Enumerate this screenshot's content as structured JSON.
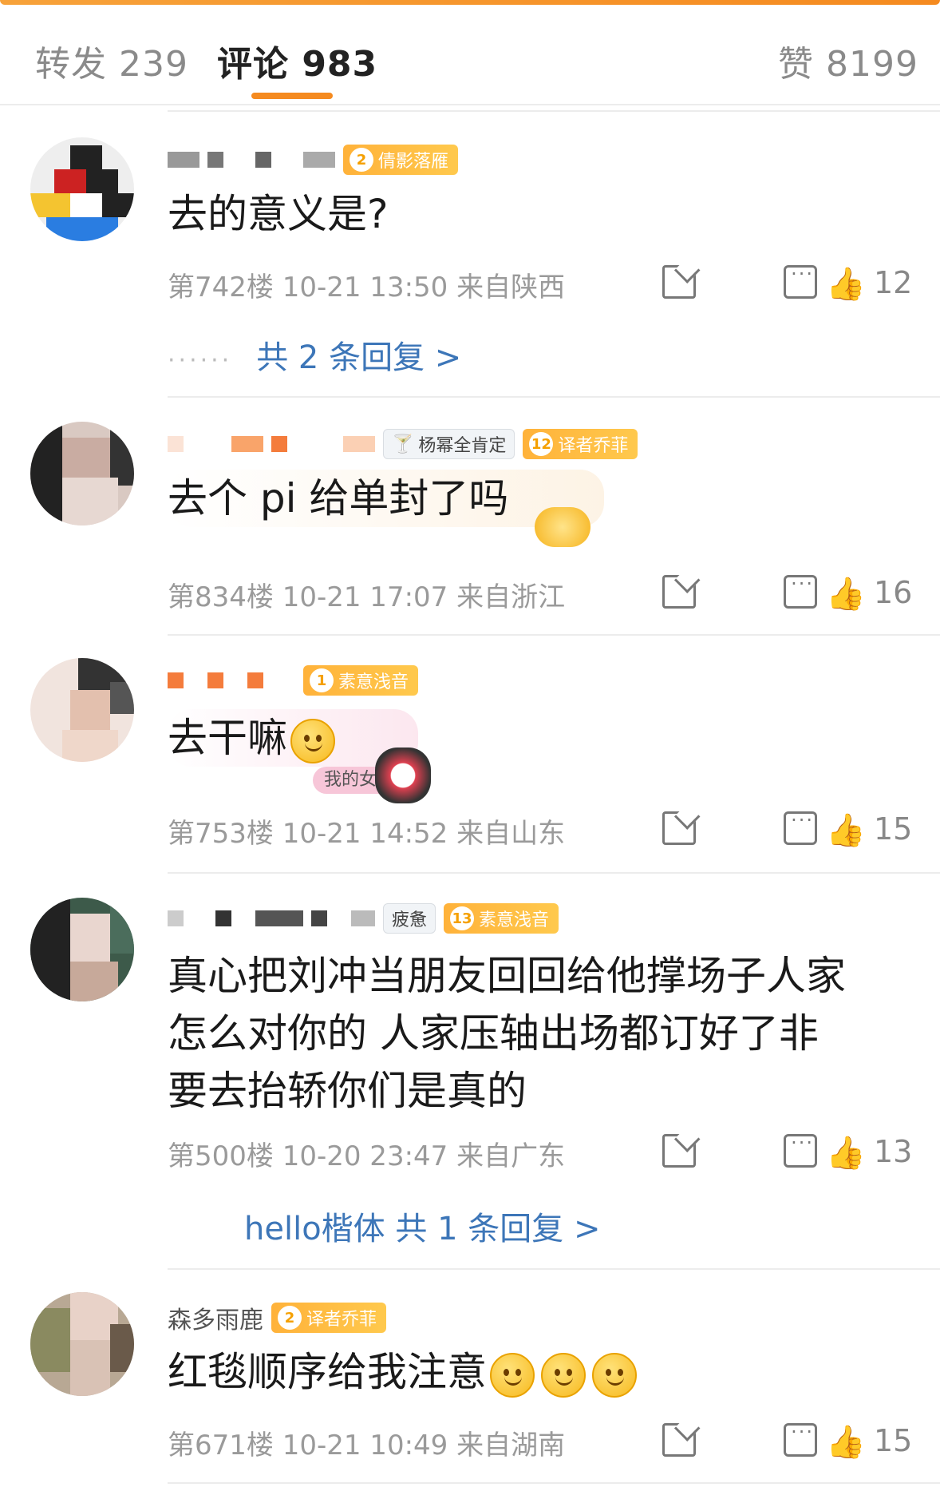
{
  "tabs": {
    "repost": "转发 239",
    "comments": "评论 983",
    "likes": "赞 8199"
  },
  "comments": [
    {
      "badges": [
        {
          "level": "2",
          "label": "倩影落雁"
        }
      ],
      "text": "去的意义是?",
      "meta": "第742楼 10-21 13:50 来自陕西",
      "likes": "12",
      "replies": "共 2 条回复 >"
    },
    {
      "badges": [
        {
          "label": "杨幂全肯定"
        },
        {
          "level": "12",
          "label": "译者乔菲"
        }
      ],
      "text": "去个 pi 给单封了吗",
      "meta": "第834楼 10-21 17:07 来自浙江",
      "likes": "16"
    },
    {
      "badges": [
        {
          "level": "1",
          "label": "素意浅音"
        }
      ],
      "text": "去干嘛",
      "sticker": "我的女郎",
      "meta": "第753楼 10-21 14:52 来自山东",
      "likes": "15"
    },
    {
      "badges": [
        {
          "label": "疲惫"
        },
        {
          "level": "13",
          "label": "素意浅音"
        }
      ],
      "text_lines": [
        "真心把刘冲当朋友回回给他撑场子人家",
        "怎么对你的 人家压轴出场都订好了非",
        "要去抬轿你们是真的"
      ],
      "meta": "第500楼 10-20 23:47 来自广东",
      "likes": "13",
      "replies": "hello楷体  共 1 条回复 >"
    },
    {
      "name_partial": "森多雨鹿",
      "badges": [
        {
          "level": "2",
          "label": "译者乔菲"
        }
      ],
      "text": "红毯顺序给我注意",
      "meta": "第671楼 10-21 10:49 来自湖南",
      "likes": "15"
    }
  ],
  "icons": [
    "share-icon",
    "reply-icon",
    "like-icon"
  ],
  "colors": {
    "accent": "#f58a1f",
    "link": "#3d76b8",
    "badge": "#ffb23a"
  }
}
